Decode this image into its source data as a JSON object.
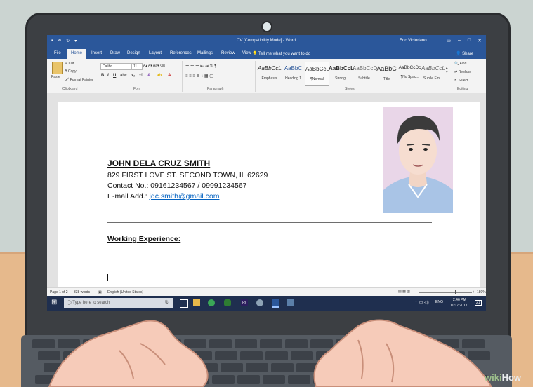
{
  "window": {
    "title": "CV [Compatibility Mode] - Word",
    "user": "Eric Victoriano"
  },
  "tabs": [
    "File",
    "Home",
    "Insert",
    "Draw",
    "Design",
    "Layout",
    "References",
    "Mailings",
    "Review",
    "View"
  ],
  "active_tab": "Home",
  "tell_me": "Tell me what you want to do",
  "share": "Share",
  "clipboard": {
    "paste": "Paste",
    "cut": "Cut",
    "copy": "Copy",
    "format_painter": "Format Painter",
    "label": "Clipboard"
  },
  "font": {
    "name": "Calibri",
    "size": "11",
    "label": "Font"
  },
  "paragraph": {
    "label": "Paragraph"
  },
  "styles": {
    "label": "Styles",
    "items": [
      {
        "sample": "AaBbCcL",
        "name": "Emphasis"
      },
      {
        "sample": "AaBbC",
        "name": "Heading 1"
      },
      {
        "sample": "AaBbCcL",
        "name": "¶Normal"
      },
      {
        "sample": "AaBbCcL",
        "name": "Strong"
      },
      {
        "sample": "AaBbCcD",
        "name": "Subtitle"
      },
      {
        "sample": "AaBbC",
        "name": "Title"
      },
      {
        "sample": "AaBbCcDc",
        "name": "¶No Spac..."
      },
      {
        "sample": "AaBbCcL",
        "name": "Subtle Em..."
      }
    ]
  },
  "editing": {
    "find": "Find",
    "replace": "Replace",
    "select": "Select",
    "label": "Editing"
  },
  "document": {
    "name": "JOHN DELA CRUZ SMITH",
    "address": "829 FIRST LOVE ST. SECOND TOWN, IL 62629",
    "contact": "Contact No.: 09161234567 / 09991234567",
    "email_label": "E-mail Add.: ",
    "email": "jdc.smith@gmail.com",
    "section": "Working Experience:"
  },
  "status": {
    "page": "Page 1 of 2",
    "words": "338 words",
    "language": "English (United States)",
    "zoom": "180%"
  },
  "taskbar": {
    "search_placeholder": "Type here to search",
    "time": "2:46 PM",
    "date": "11/17/2017",
    "lang": "ENG",
    "notif": "21"
  },
  "brand": {
    "wiki": "wiki",
    "how": "How"
  },
  "colors": {
    "word_blue": "#2b579a",
    "taskbar": "#1f2f4f",
    "desk": "#e6b98c"
  }
}
